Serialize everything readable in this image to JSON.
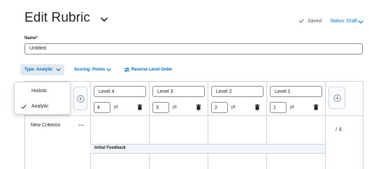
{
  "header": {
    "title": "Edit Rubric",
    "saved_text": "Saved",
    "status_text": "Status: Draft"
  },
  "name_field": {
    "label": "Name*",
    "value": "Untitled"
  },
  "toolbar": {
    "type_label": "Type: Analytic",
    "scoring_label": "Scoring: Points",
    "reverse_label": "Reverse Level Order"
  },
  "type_menu": {
    "options": [
      "Holistic",
      "Analytic"
    ],
    "selected": "Analytic"
  },
  "levels": [
    {
      "name": "Level 4",
      "points": "4",
      "unit": "pt"
    },
    {
      "name": "Level 3",
      "points": "3",
      "unit": "pt"
    },
    {
      "name": "Level 2",
      "points": "2",
      "unit": "pt"
    },
    {
      "name": "Level 1",
      "points": "1",
      "unit": "pt"
    }
  ],
  "criteria": [
    {
      "name": "New Criterion",
      "more": "...",
      "points_out_of": "/ 4"
    }
  ],
  "feedback": {
    "label": "Initial Feedback"
  },
  "colors": {
    "accent": "#006fbf",
    "grid": "#cdd5dc",
    "menu_selected_bg": "#ffffff"
  }
}
